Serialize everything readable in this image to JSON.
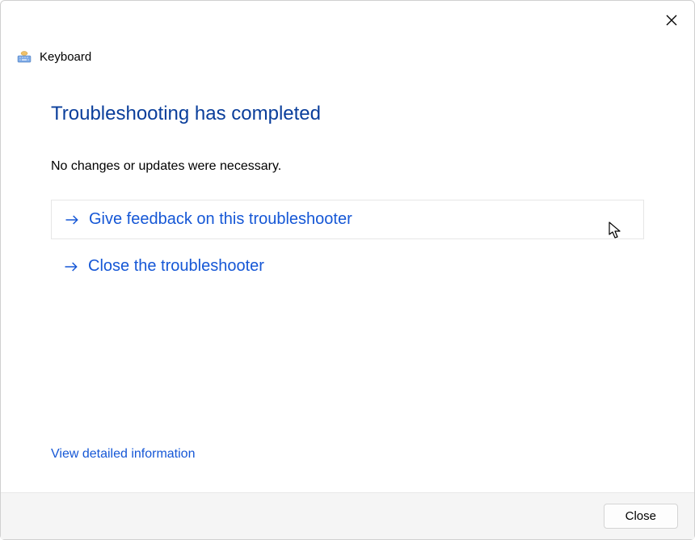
{
  "window": {
    "title": "Keyboard"
  },
  "main": {
    "heading": "Troubleshooting has completed",
    "status": "No changes or updates were necessary.",
    "option_feedback": "Give feedback on this troubleshooter",
    "option_close": "Close the troubleshooter",
    "detail_link": "View detailed information"
  },
  "footer": {
    "close_label": "Close"
  }
}
